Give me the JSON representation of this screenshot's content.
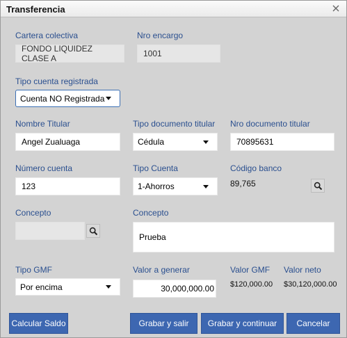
{
  "window": {
    "title": "Transferencia"
  },
  "cartera": {
    "label": "Cartera colectiva",
    "value": "FONDO LIQUIDEZ CLASE A"
  },
  "encargo": {
    "label": "Nro encargo",
    "value": "1001"
  },
  "tipo_cuenta_reg": {
    "label": "Tipo cuenta registrada",
    "value": "Cuenta NO Registrada"
  },
  "nombre_titular": {
    "label": "Nombre Titular",
    "value": "Angel Zualuaga"
  },
  "tipo_doc": {
    "label": "Tipo documento titular",
    "value": "Cédula"
  },
  "nro_doc": {
    "label": "Nro documento titular",
    "value": "70895631"
  },
  "numero_cuenta": {
    "label": "Número cuenta",
    "value": "123"
  },
  "tipo_cuenta": {
    "label": "Tipo Cuenta",
    "value": "1-Ahorros"
  },
  "codigo_banco": {
    "label": "Código banco",
    "value": "89,765"
  },
  "concepto_lookup": {
    "label": "Concepto",
    "value": ""
  },
  "concepto": {
    "label": "Concepto",
    "value": "Prueba"
  },
  "tipo_gmf": {
    "label": "Tipo GMF",
    "value": "Por encima"
  },
  "valor_generar": {
    "label": "Valor a generar",
    "value": "30,000,000.00"
  },
  "valor_gmf": {
    "label": "Valor GMF",
    "value": "$120,000.00"
  },
  "valor_neto": {
    "label": "Valor neto",
    "value": "$30,120,000.00"
  },
  "buttons": {
    "calcular": "Calcular Saldo",
    "grabar_salir": "Grabar y salir",
    "grabar_continuar": "Grabar y continuar",
    "cancelar": "Cancelar"
  },
  "icons": {
    "close": "close-icon",
    "search": "search-icon"
  }
}
